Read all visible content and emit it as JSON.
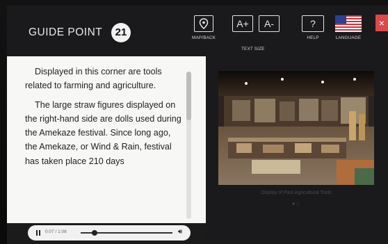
{
  "header": {
    "title": "GUIDE POINT",
    "point_number": "21"
  },
  "toolbar": {
    "map_label": "MAP/BACK",
    "text_size_label": "TEXT SIZE",
    "text_up": "A+",
    "text_down": "A-",
    "help_label": "HELP",
    "help_glyph": "?",
    "language_label": "LANGUAGE",
    "close_glyph": "×"
  },
  "content": {
    "paragraphs": [
      "Displayed in this corner are tools related to farming and agriculture.",
      "The large straw figures displayed on the right-hand side are dolls used during the Amekaze festival. Since long ago, the Amekaze, or Wind & Rain, festival has taken place 210 days"
    ]
  },
  "audio": {
    "time": "0:07 / 1:08",
    "progress": 0.15
  },
  "gallery": {
    "caption": "Display of Past Agricultural Tools",
    "dots": "● ○"
  },
  "colors": {
    "close": "#d94a4a",
    "panel": "#f7f7f5"
  }
}
